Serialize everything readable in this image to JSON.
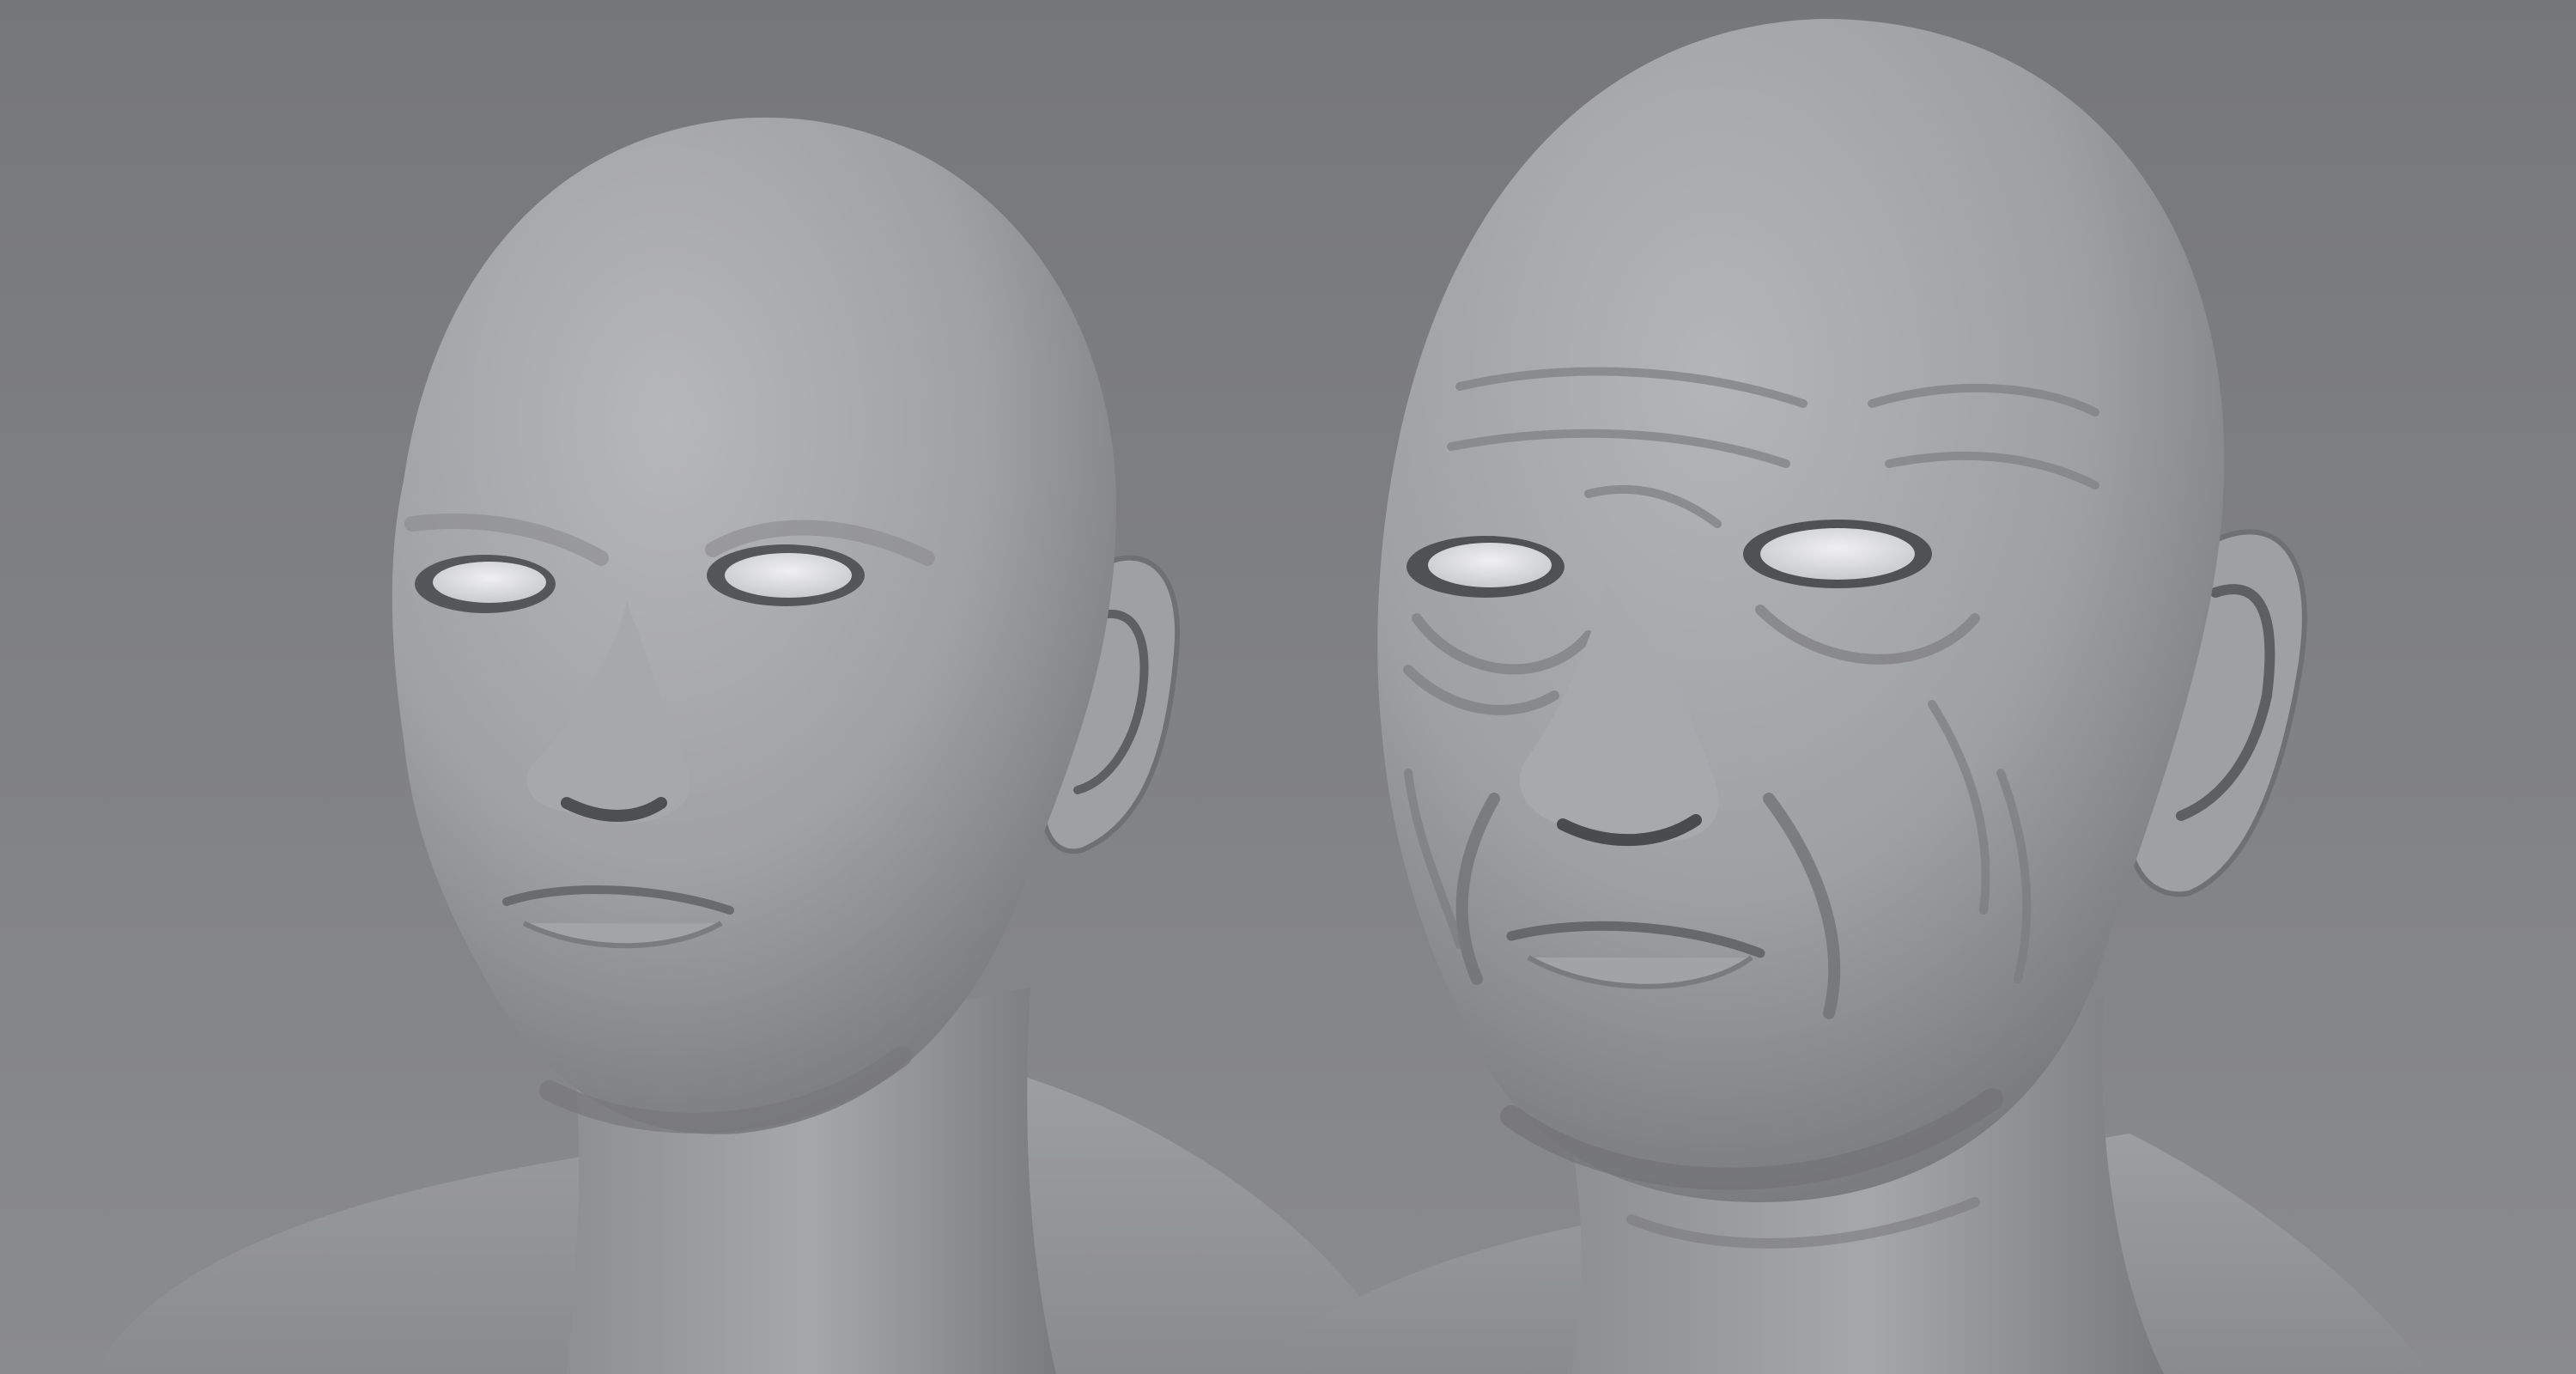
{
  "scene": {
    "kind": "3d-render",
    "subject_count": 2,
    "colors": {
      "background_top": "#76777a",
      "background_bottom": "#8a8b8e",
      "skin_light": "#b3b4b6",
      "skin_mid": "#9c9da0",
      "skin_shadow": "#6d6e71",
      "eye_white": "#e8e8ea",
      "eye_shadow": "#4a4b4e"
    },
    "busts": [
      {
        "name": "younger-head",
        "variant": "smooth"
      },
      {
        "name": "older-head",
        "variant": "wrinkled"
      }
    ]
  }
}
